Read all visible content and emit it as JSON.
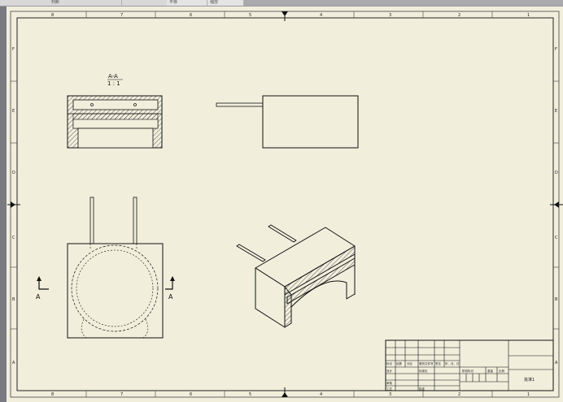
{
  "toolbar": {
    "item_1": "判断",
    "item_2": "平移",
    "item_3": "缩放"
  },
  "drawing": {
    "section_title": "A-A",
    "section_scale": "1 : 1",
    "view_label_left": "A",
    "view_label_right": "A"
  },
  "zones": {
    "columns": [
      "8",
      "7",
      "6",
      "5",
      "4",
      "3",
      "2",
      "1"
    ],
    "rows": [
      "F",
      "E",
      "D",
      "C",
      "B",
      "A"
    ]
  },
  "title_block": {
    "headers": [
      "标记",
      "处数",
      "分区",
      "更改文件号",
      "签名",
      "年、月、日"
    ],
    "design_row": [
      "设计",
      "标准化"
    ],
    "review_row": [
      "审核"
    ],
    "process_row": [
      "工艺",
      "批准"
    ],
    "stage_label": "阶段标记",
    "weight_label": "重量",
    "scale_label": "比例",
    "sheet_name": "批准1"
  }
}
